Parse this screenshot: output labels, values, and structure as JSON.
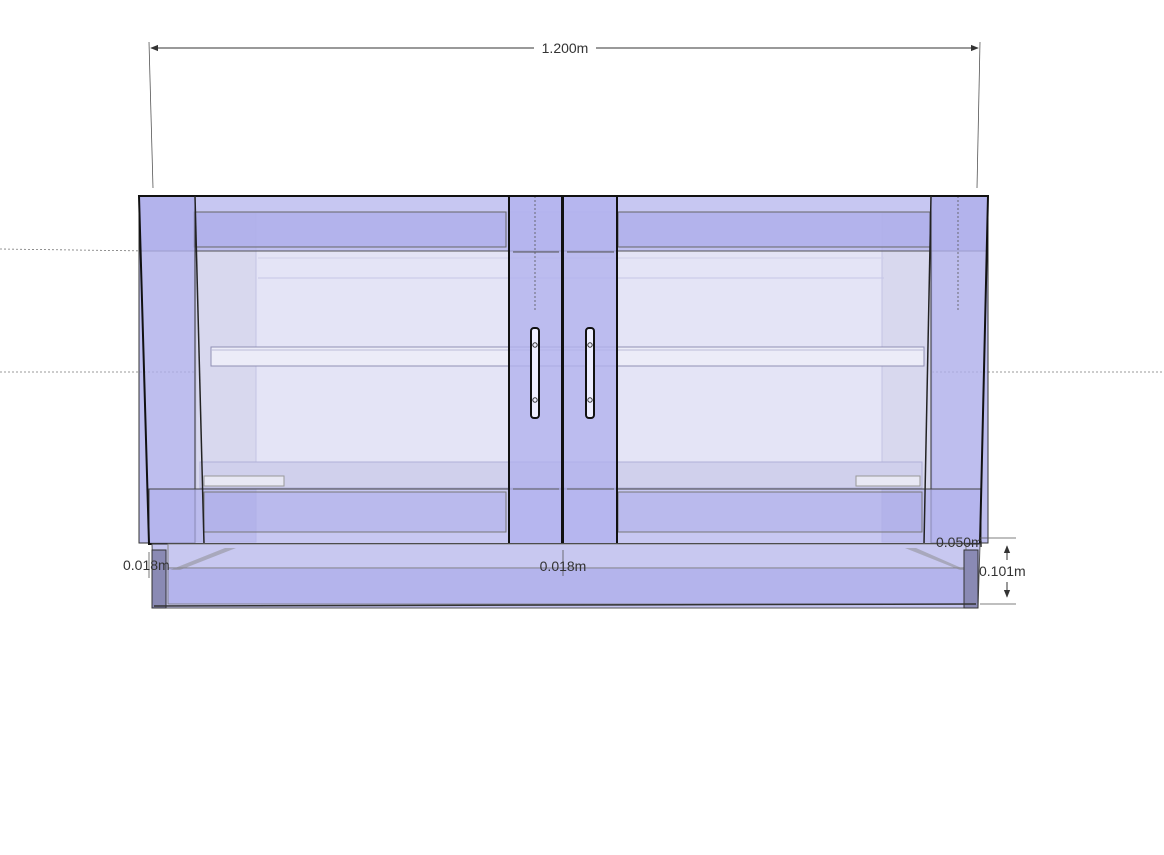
{
  "dimensions": {
    "overall_width": "1.200m",
    "left_side_thickness": "0.018m",
    "center_thickness": "0.018m",
    "kick_setback": "0.050m",
    "kick_height": "0.101m"
  },
  "colors": {
    "panel_fill": "#b8b8ee",
    "panel_fill_dark": "#a4a4e4",
    "interior_fill": "#dedef4",
    "back_fill": "#e6e6f6",
    "edge": "#111111",
    "dimension_line": "#333333"
  }
}
